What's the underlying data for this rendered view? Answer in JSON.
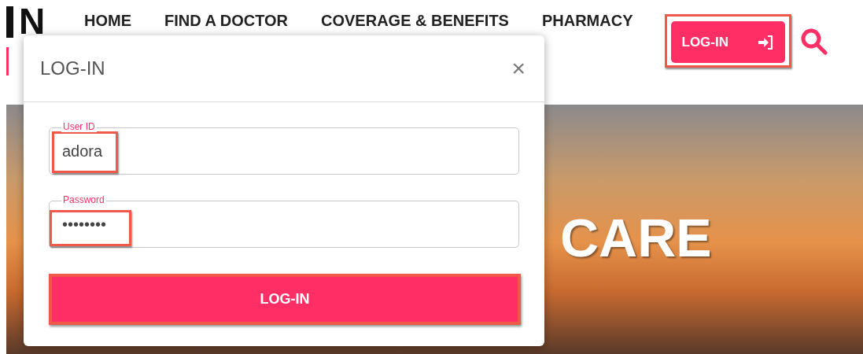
{
  "logo": {
    "lines": [
      "N"
    ]
  },
  "nav": [
    {
      "label": "HOME"
    },
    {
      "label": "FIND A DOCTOR"
    },
    {
      "label": "COVERAGE & BENEFITS"
    },
    {
      "label": "PHARMACY"
    }
  ],
  "header_login": {
    "label": "LOG-IN",
    "highlighted": true
  },
  "hero": {
    "text_parts": [
      "CARE"
    ]
  },
  "modal": {
    "title": "LOG-IN",
    "close": "×",
    "fields": [
      {
        "label": "User ID",
        "value": "adora",
        "highlighted": true
      },
      {
        "label": "Password",
        "value": "••••••••",
        "highlighted": true
      }
    ],
    "submit": {
      "label": "LOG-IN",
      "highlighted": true
    }
  }
}
